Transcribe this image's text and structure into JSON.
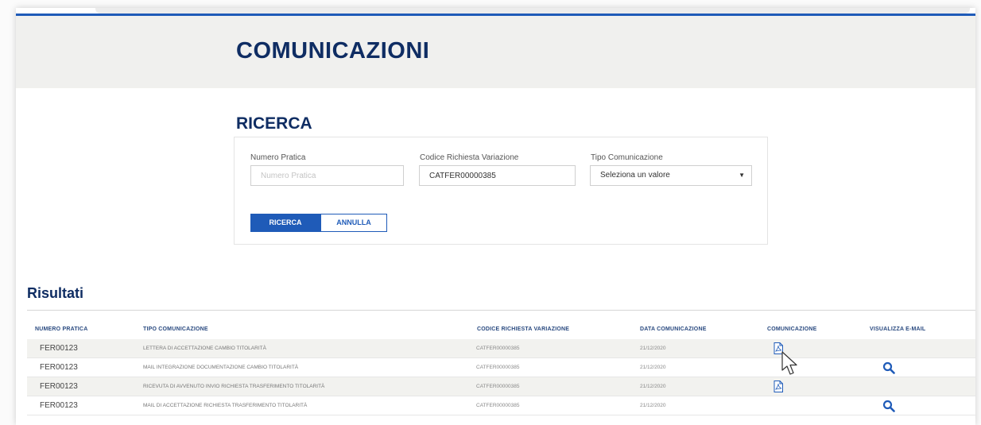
{
  "header": {
    "title": "COMUNICAZIONI"
  },
  "search": {
    "title": "RICERCA",
    "numero_pratica": {
      "label": "Numero Pratica",
      "value": "",
      "placeholder": "Numero Pratica"
    },
    "codice_richiesta": {
      "label": "Codice Richiesta Variazione",
      "value": "CATFER00000385",
      "placeholder": ""
    },
    "tipo_comunicazione": {
      "label": "Tipo Comunicazione",
      "selected": "Seleziona un valore"
    },
    "search_button": "RICERCA",
    "cancel_button": "ANNULLA"
  },
  "results": {
    "title": "Risultati",
    "columns": [
      "NUMERO PRATICA",
      "TIPO COMUNICAZIONE",
      "CODICE RICHIESTA VARIAZIONE",
      "DATA COMUNICAZIONE",
      "COMUNICAZIONE",
      "VISUALIZZA E-MAIL"
    ],
    "rows": [
      {
        "numero": "FER00123",
        "tipo": "LETTERA DI ACCETTAZIONE CAMBIO TITOLARITÀ",
        "codice": "CATFER00000385",
        "data": "21/12/2020",
        "comunicazione_icon": "pdf-icon",
        "email_icon": ""
      },
      {
        "numero": "FER00123",
        "tipo": "MAIL INTEGRAZIONE DOCUMENTAZIONE CAMBIO TITOLARITÀ",
        "codice": "CATFER00000385",
        "data": "21/12/2020",
        "comunicazione_icon": "",
        "email_icon": "search-icon"
      },
      {
        "numero": "FER00123",
        "tipo": "RICEVUTA DI AVVENUTO INVIO RICHIESTA TRASFERIMENTO TITOLARITÀ",
        "codice": "CATFER00000385",
        "data": "21/12/2020",
        "comunicazione_icon": "pdf-icon",
        "email_icon": ""
      },
      {
        "numero": "FER00123",
        "tipo": "MAIL DI ACCETTAZIONE RICHIESTA TRASFERIMENTO TITOLARITÀ",
        "codice": "CATFER00000385",
        "data": "21/12/2020",
        "comunicazione_icon": "",
        "email_icon": "search-icon"
      }
    ]
  },
  "colors": {
    "primary": "#1f5bb8",
    "title": "#0f2d63",
    "header_band": "#f0f0ee",
    "row_shade": "#f2f2ef"
  }
}
